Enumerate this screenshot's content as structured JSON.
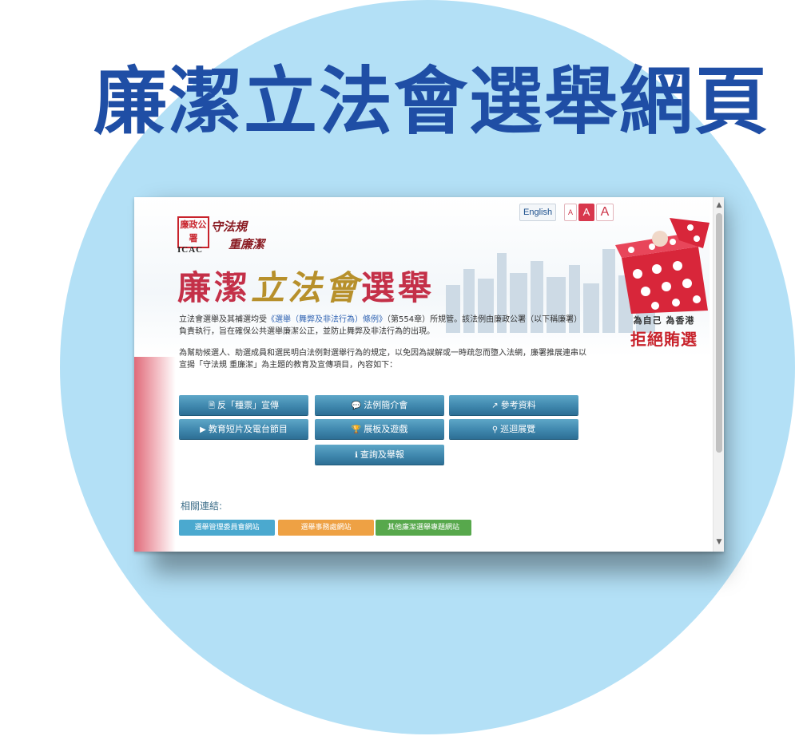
{
  "headline": "廉潔立法會選舉網頁",
  "header": {
    "logo_text": "廉政公署",
    "logo_org": "ICAC",
    "slogan_line1": "守法規",
    "slogan_line2": "重廉潔",
    "title_left": "廉潔",
    "title_mid": "立法會",
    "title_right": "選舉",
    "lang_label": "English",
    "font_small": "A",
    "font_medium": "A",
    "font_large": "A"
  },
  "banner": {
    "sub": "為自己 為香港",
    "main": "拒絕賄選"
  },
  "intro": {
    "p1_before": "立法會選舉及其補選均受",
    "p1_link": "《選舉（舞弊及非法行為）條例》",
    "p1_after": "（第554章）所規管。該法例由廉政公署（以下稱廉署）負責執行，旨在確保公共選舉廉潔公正，並防止舞弊及非法行為的出現。",
    "p2": "為幫助候選人、助選成員和選民明白法例對選舉行為的規定，以免因為誤解或一時疏忽而墮入法網，廉署推展連串以宣揚「守法規 重廉潔」為主題的教育及宣傳項目，內容如下："
  },
  "menu": [
    {
      "label": "反「種票」宣傳",
      "icon": "document-icon",
      "glyph": "🗎"
    },
    {
      "label": "法例簡介會",
      "icon": "chat-icon",
      "glyph": "💬"
    },
    {
      "label": "參考資料",
      "icon": "external-link-icon",
      "glyph": "↗"
    },
    {
      "label": "教育短片及電台節目",
      "icon": "video-icon",
      "glyph": "▶"
    },
    {
      "label": "展板及遊戲",
      "icon": "trophy-icon",
      "glyph": "🏆"
    },
    {
      "label": "巡迴展覽",
      "icon": "map-marker-icon",
      "glyph": "⚲"
    },
    {
      "label": "查詢及舉報",
      "icon": "info-icon",
      "glyph": "ℹ"
    }
  ],
  "related": {
    "heading": "相關連結:",
    "links": [
      "選舉管理委員會網站",
      "選舉事務處網站",
      "其他廉潔選舉專題網站"
    ]
  },
  "colors": {
    "headline": "#1f4ea5",
    "circle": "#b3e0f6",
    "button": "#3f87ad",
    "link_blue": "#4ba9cf",
    "link_orange": "#eea144",
    "link_green": "#57a84c"
  }
}
